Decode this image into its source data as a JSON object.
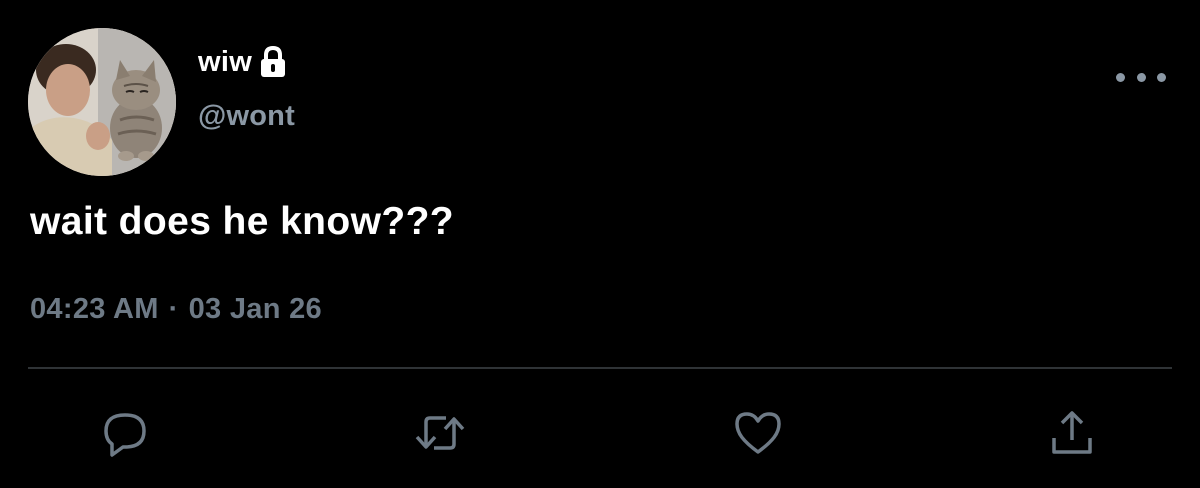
{
  "user": {
    "display_name": "wiw",
    "handle": "@wont",
    "avatar_icon": "profile-photo-boy-with-kitten",
    "lock_icon": "lock-icon"
  },
  "tweet": {
    "text": "wait does he know???",
    "time": "04:23 AM",
    "separator": "·",
    "date": "03 Jan 26"
  },
  "actions": [
    {
      "icon": "reply-icon"
    },
    {
      "icon": "retweet-icon"
    },
    {
      "icon": "like-icon"
    },
    {
      "icon": "share-icon"
    }
  ],
  "colors": {
    "background": "#000000",
    "primary_text": "#ffffff",
    "secondary_text": "#8b98a5",
    "divider": "#2f3336"
  }
}
